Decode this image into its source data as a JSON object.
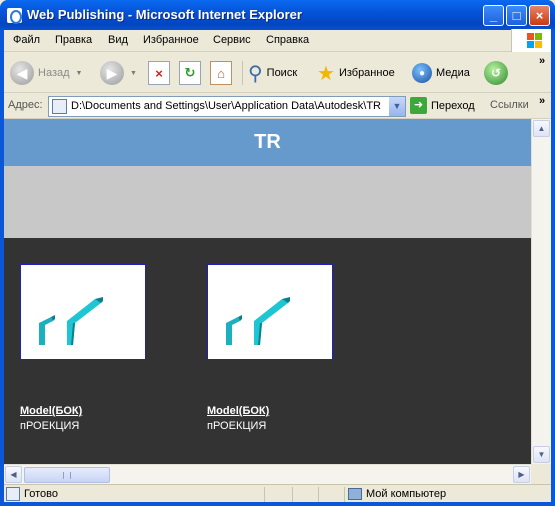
{
  "window": {
    "title": "Web Publishing - Microsoft Internet Explorer",
    "controls": {
      "minimize": "_",
      "maximize": "□",
      "close": "×"
    }
  },
  "menubar": {
    "items": [
      {
        "label": "Файл"
      },
      {
        "label": "Правка"
      },
      {
        "label": "Вид"
      },
      {
        "label": "Избранное"
      },
      {
        "label": "Сервис"
      },
      {
        "label": "Справка"
      }
    ]
  },
  "toolbar": {
    "back_label": "Назад",
    "search_label": "Поиск",
    "favorites_label": "Избранное",
    "media_label": "Медиа",
    "overflow": "»"
  },
  "addressbar": {
    "label": "Адрес:",
    "value": "D:\\Documents and Settings\\User\\Application Data\\Autodesk\\TR\\a",
    "go_label": "Переход",
    "links_label": "Ссылки",
    "overflow": "»"
  },
  "page": {
    "header_title": "TR",
    "items": [
      {
        "title": "Model(БОК)",
        "subtitle": "пРОЕКЦИЯ"
      },
      {
        "title": "Model(БОК)",
        "subtitle": "пРОЕКЦИЯ"
      }
    ]
  },
  "statusbar": {
    "status": "Готово",
    "zone": "Мой компьютер"
  },
  "colors": {
    "header_bg": "#6699cc",
    "band_bg": "#c8c8c8",
    "content_bg": "#333333",
    "titlebar": "#0a58d8"
  }
}
